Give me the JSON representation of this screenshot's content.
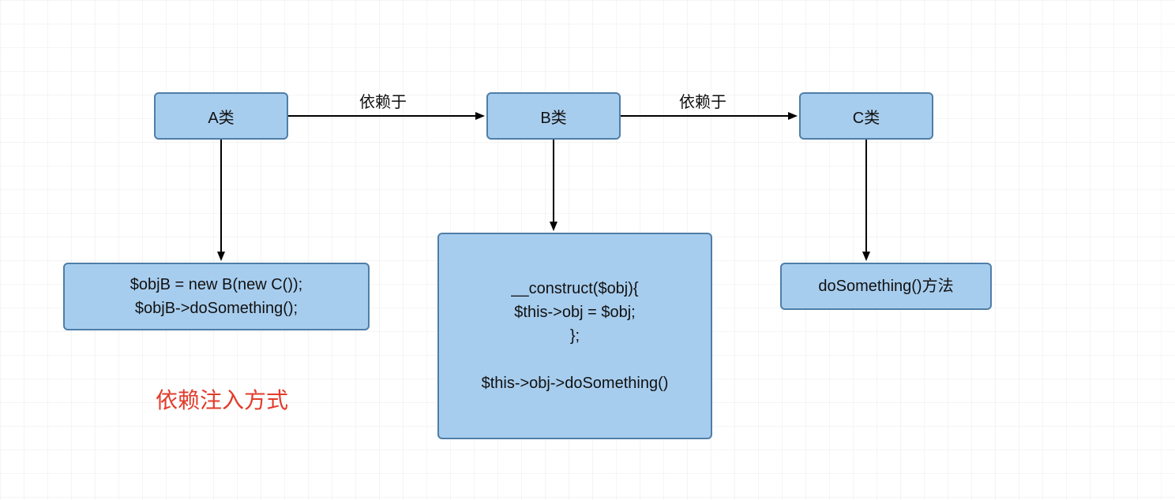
{
  "nodes": {
    "a": {
      "label": "A类"
    },
    "b": {
      "label": "B类"
    },
    "c": {
      "label": "C类"
    },
    "aCode": {
      "label": "$objB = new B(new C());\n$objB->doSomething();"
    },
    "bCode": {
      "label": "__construct($obj){\n$this->obj = $obj;\n};\n\n$this->obj->doSomething()"
    },
    "cCode": {
      "label": "doSomething()方法"
    }
  },
  "edges": {
    "ab": {
      "label": "依赖于"
    },
    "bc": {
      "label": "依赖于"
    }
  },
  "caption": "依赖注入方式",
  "colors": {
    "nodeFill": "#a7cdee",
    "nodeStroke": "#4f7ea8",
    "captionColor": "#e23b2a"
  }
}
